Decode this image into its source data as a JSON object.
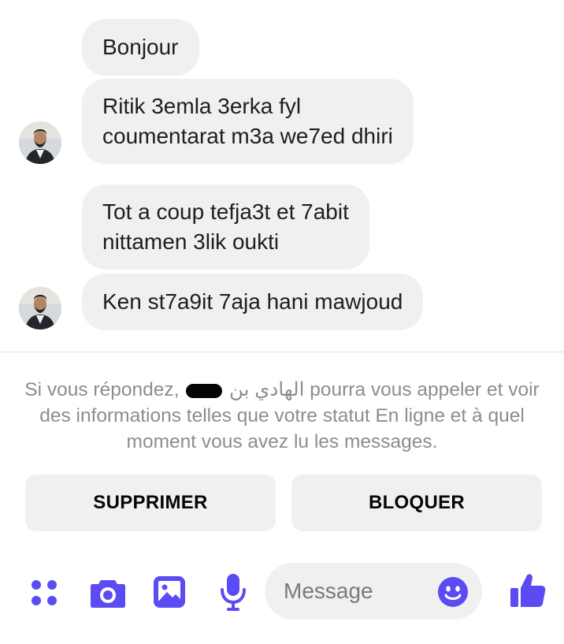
{
  "messages": [
    {
      "lines": [
        "Bonjour"
      ]
    },
    {
      "lines": [
        "Ritik 3emla 3erka fyl",
        "coumentarat m3a we7ed dhiri"
      ]
    },
    {
      "lines": [
        "Tot a coup tefja3t et 7abit",
        "nittamen 3lik oukti"
      ]
    },
    {
      "lines": [
        "Ken st7a9it 7aja hani mawjoud"
      ]
    }
  ],
  "notice": {
    "before": "Si vous répondez,",
    "name": "الهادي بن",
    "after": "pourra vous appeler et voir des informations telles que votre statut En ligne et à quel moment vous avez lu les messages."
  },
  "actions": {
    "delete_label": "SUPPRIMER",
    "block_label": "BLOQUER"
  },
  "composer": {
    "placeholder": "Message"
  },
  "colors": {
    "accent": "#5b4bf2",
    "bubble": "#f0f0f0",
    "notice_text": "#8a8d91"
  },
  "icons": [
    "apps-icon",
    "camera-icon",
    "gallery-icon",
    "microphone-icon",
    "emoji-icon",
    "like-icon"
  ]
}
